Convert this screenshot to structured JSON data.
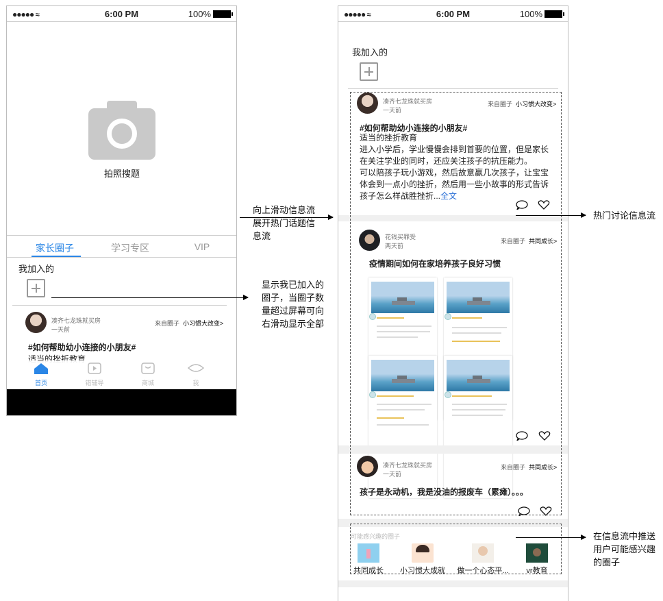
{
  "left_phone": {
    "status": {
      "signal": "●●●●● ",
      "time": "6:00 PM",
      "battery": "100%"
    },
    "camera_label": "拍照搜题",
    "tabs": [
      "家长圈子",
      "学习专区",
      "VIP"
    ],
    "joined_title": "我加入的",
    "post": {
      "author": "凑齐七龙珠就买房",
      "time": "一天前",
      "from_label": "来自圈子",
      "circle": "小习惯大改变>",
      "title": "#如何帮助幼小连接的小朋友#",
      "subtitle": "适当的挫折教育"
    },
    "bottom_nav": [
      "首页",
      "错辅导",
      "商城",
      "我"
    ]
  },
  "right_phone": {
    "status": {
      "signal": "●●●●● ",
      "time": "6:00 PM",
      "battery": "100%"
    },
    "joined_title": "我加入的",
    "post1": {
      "author": "凑齐七龙珠就买房",
      "time": "一天前",
      "from_label": "来自圈子",
      "circle": "小习惯大改变>",
      "title": "#如何帮助幼小连接的小朋友#",
      "subtitle": "适当的挫折教育",
      "body1": "进入小学后，学业慢慢会排到首要的位置，但是家长在关注学业的同时，还应关注孩子的抗压能力。",
      "body2": "可以陪孩子玩小游戏，然后故意赢几次孩子，让宝宝体会到一点小的挫折，然后用一些小故事的形式告诉孩子怎么样战胜挫折...",
      "more": "全文"
    },
    "post2": {
      "author": "花钱买罪受",
      "time": "两天前",
      "from_label": "来自圈子",
      "circle": "共同成长>",
      "title": "疫情期间如何在家培养孩子良好习惯"
    },
    "post3": {
      "author": "凑齐七龙珠就买房",
      "time": "一天前",
      "from_label": "来自圈子",
      "circle": "共同成长>",
      "title": "孩子是永动机，我是没油的报废车（累瘫）。。。"
    },
    "suggest": {
      "title": "可能感兴趣的圈子",
      "items": [
        "共同成长",
        "小习惯大成就",
        "做一个心态平...",
        "vr教育"
      ]
    }
  },
  "annotations": {
    "scroll": "向上滑动信息流展开热门话题信息流",
    "joined": "显示我已加入的圈子，当圈子数量超过屏幕可向右滑动显示全部",
    "hot": "热门讨论信息流",
    "recommend": "在信息流中推送用户可能感兴趣的圈子"
  },
  "colors": {
    "accent": "#2a86e6",
    "link": "#2a6fd6",
    "gray_icon": "#c9c9c9"
  }
}
